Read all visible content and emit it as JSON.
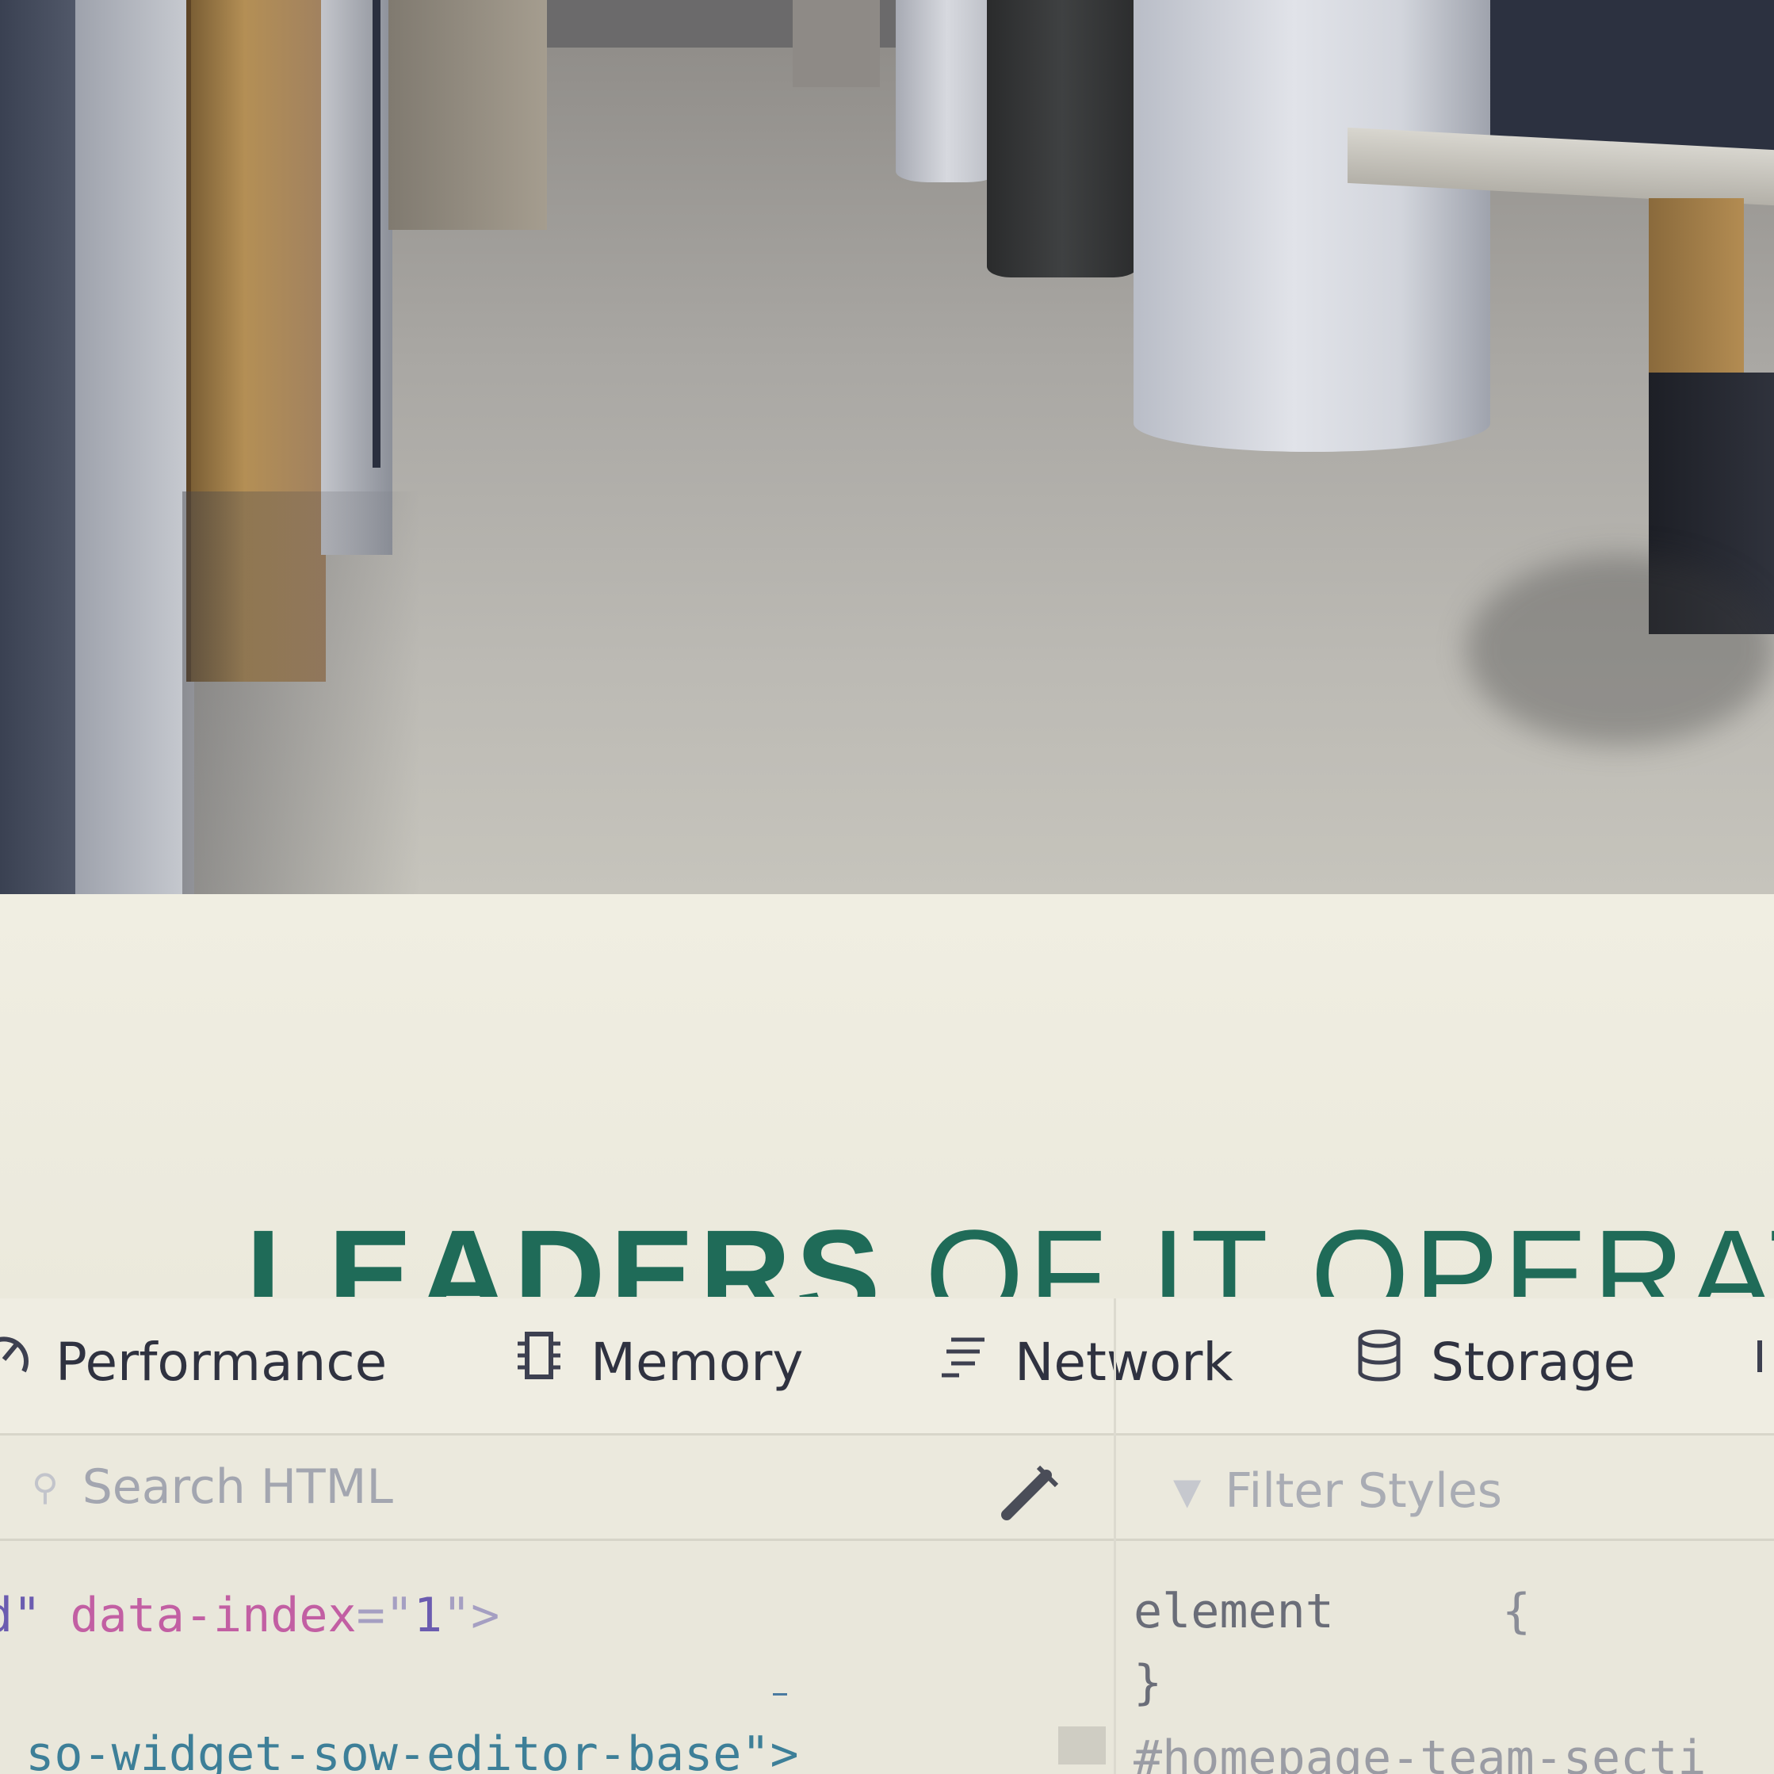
{
  "photo": {
    "description_icon": "office-hallway-photo"
  },
  "page": {
    "headline_bold": "LEADERS",
    "headline_light": " OF IT OPERATI"
  },
  "devtools": {
    "tabs": [
      {
        "label": "Performance",
        "icon": "performance-icon"
      },
      {
        "label": "Memory",
        "icon": "memory-icon"
      },
      {
        "label": "Network",
        "icon": "network-icon"
      },
      {
        "label": "Storage",
        "icon": "storage-icon"
      }
    ],
    "search_html_placeholder": "Search HTML",
    "filter_styles_placeholder": "Filter Styles",
    "markup_line1_prefix": "d\" ",
    "markup_line1_attr": "data-index",
    "markup_line1_eq": "=\"",
    "markup_line1_val": "1",
    "markup_line1_end": "\">",
    "markup_line2": "r so-widget-sow-editor-base\">",
    "rule_selector": "element",
    "rule_open": "{",
    "rule_close": "}",
    "rule_next": "#homepage-team-secti"
  },
  "colors": {
    "headline": "#1f6b58",
    "attr_name": "#c25fa3",
    "class_value": "#3d7f98"
  }
}
